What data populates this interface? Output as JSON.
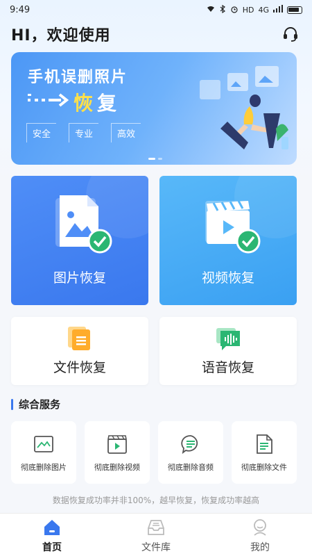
{
  "status_bar": {
    "time": "9:49",
    "indicators": "HD",
    "network": "4G"
  },
  "header": {
    "greeting": "HI，欢迎使用",
    "support_icon": "headset-icon"
  },
  "banner": {
    "title": "手机误删照片",
    "subtitle_prefix": "恢",
    "subtitle_suffix": "复",
    "tags": [
      "安全",
      "专业",
      "高效"
    ],
    "slide_count": 2,
    "active_slide": 1
  },
  "main_cards": [
    {
      "label": "图片恢复",
      "icon": "image-file-icon"
    },
    {
      "label": "视频恢复",
      "icon": "video-clapper-icon"
    }
  ],
  "secondary_cards": [
    {
      "label": "文件恢复",
      "icon": "document-icon"
    },
    {
      "label": "语音恢复",
      "icon": "voice-icon"
    }
  ],
  "section": {
    "title": "综合服务"
  },
  "services": [
    {
      "label": "彻底删除图片",
      "icon": "image-delete-icon"
    },
    {
      "label": "彻底删除视频",
      "icon": "video-delete-icon"
    },
    {
      "label": "彻底删除音频",
      "icon": "audio-delete-icon"
    },
    {
      "label": "彻底删除文件",
      "icon": "file-delete-icon"
    }
  ],
  "disclaimer": "数据恢复成功率并非100%，越早恢复，恢复成功率越高",
  "tabbar": [
    {
      "label": "首页",
      "icon": "home-icon",
      "active": true
    },
    {
      "label": "文件库",
      "icon": "inbox-icon",
      "active": false
    },
    {
      "label": "我的",
      "icon": "user-icon",
      "active": false
    }
  ],
  "colors": {
    "primary": "#3a78ee",
    "secondary": "#3aa0f2",
    "accent": "#ffe04a",
    "check": "#2bb673"
  }
}
